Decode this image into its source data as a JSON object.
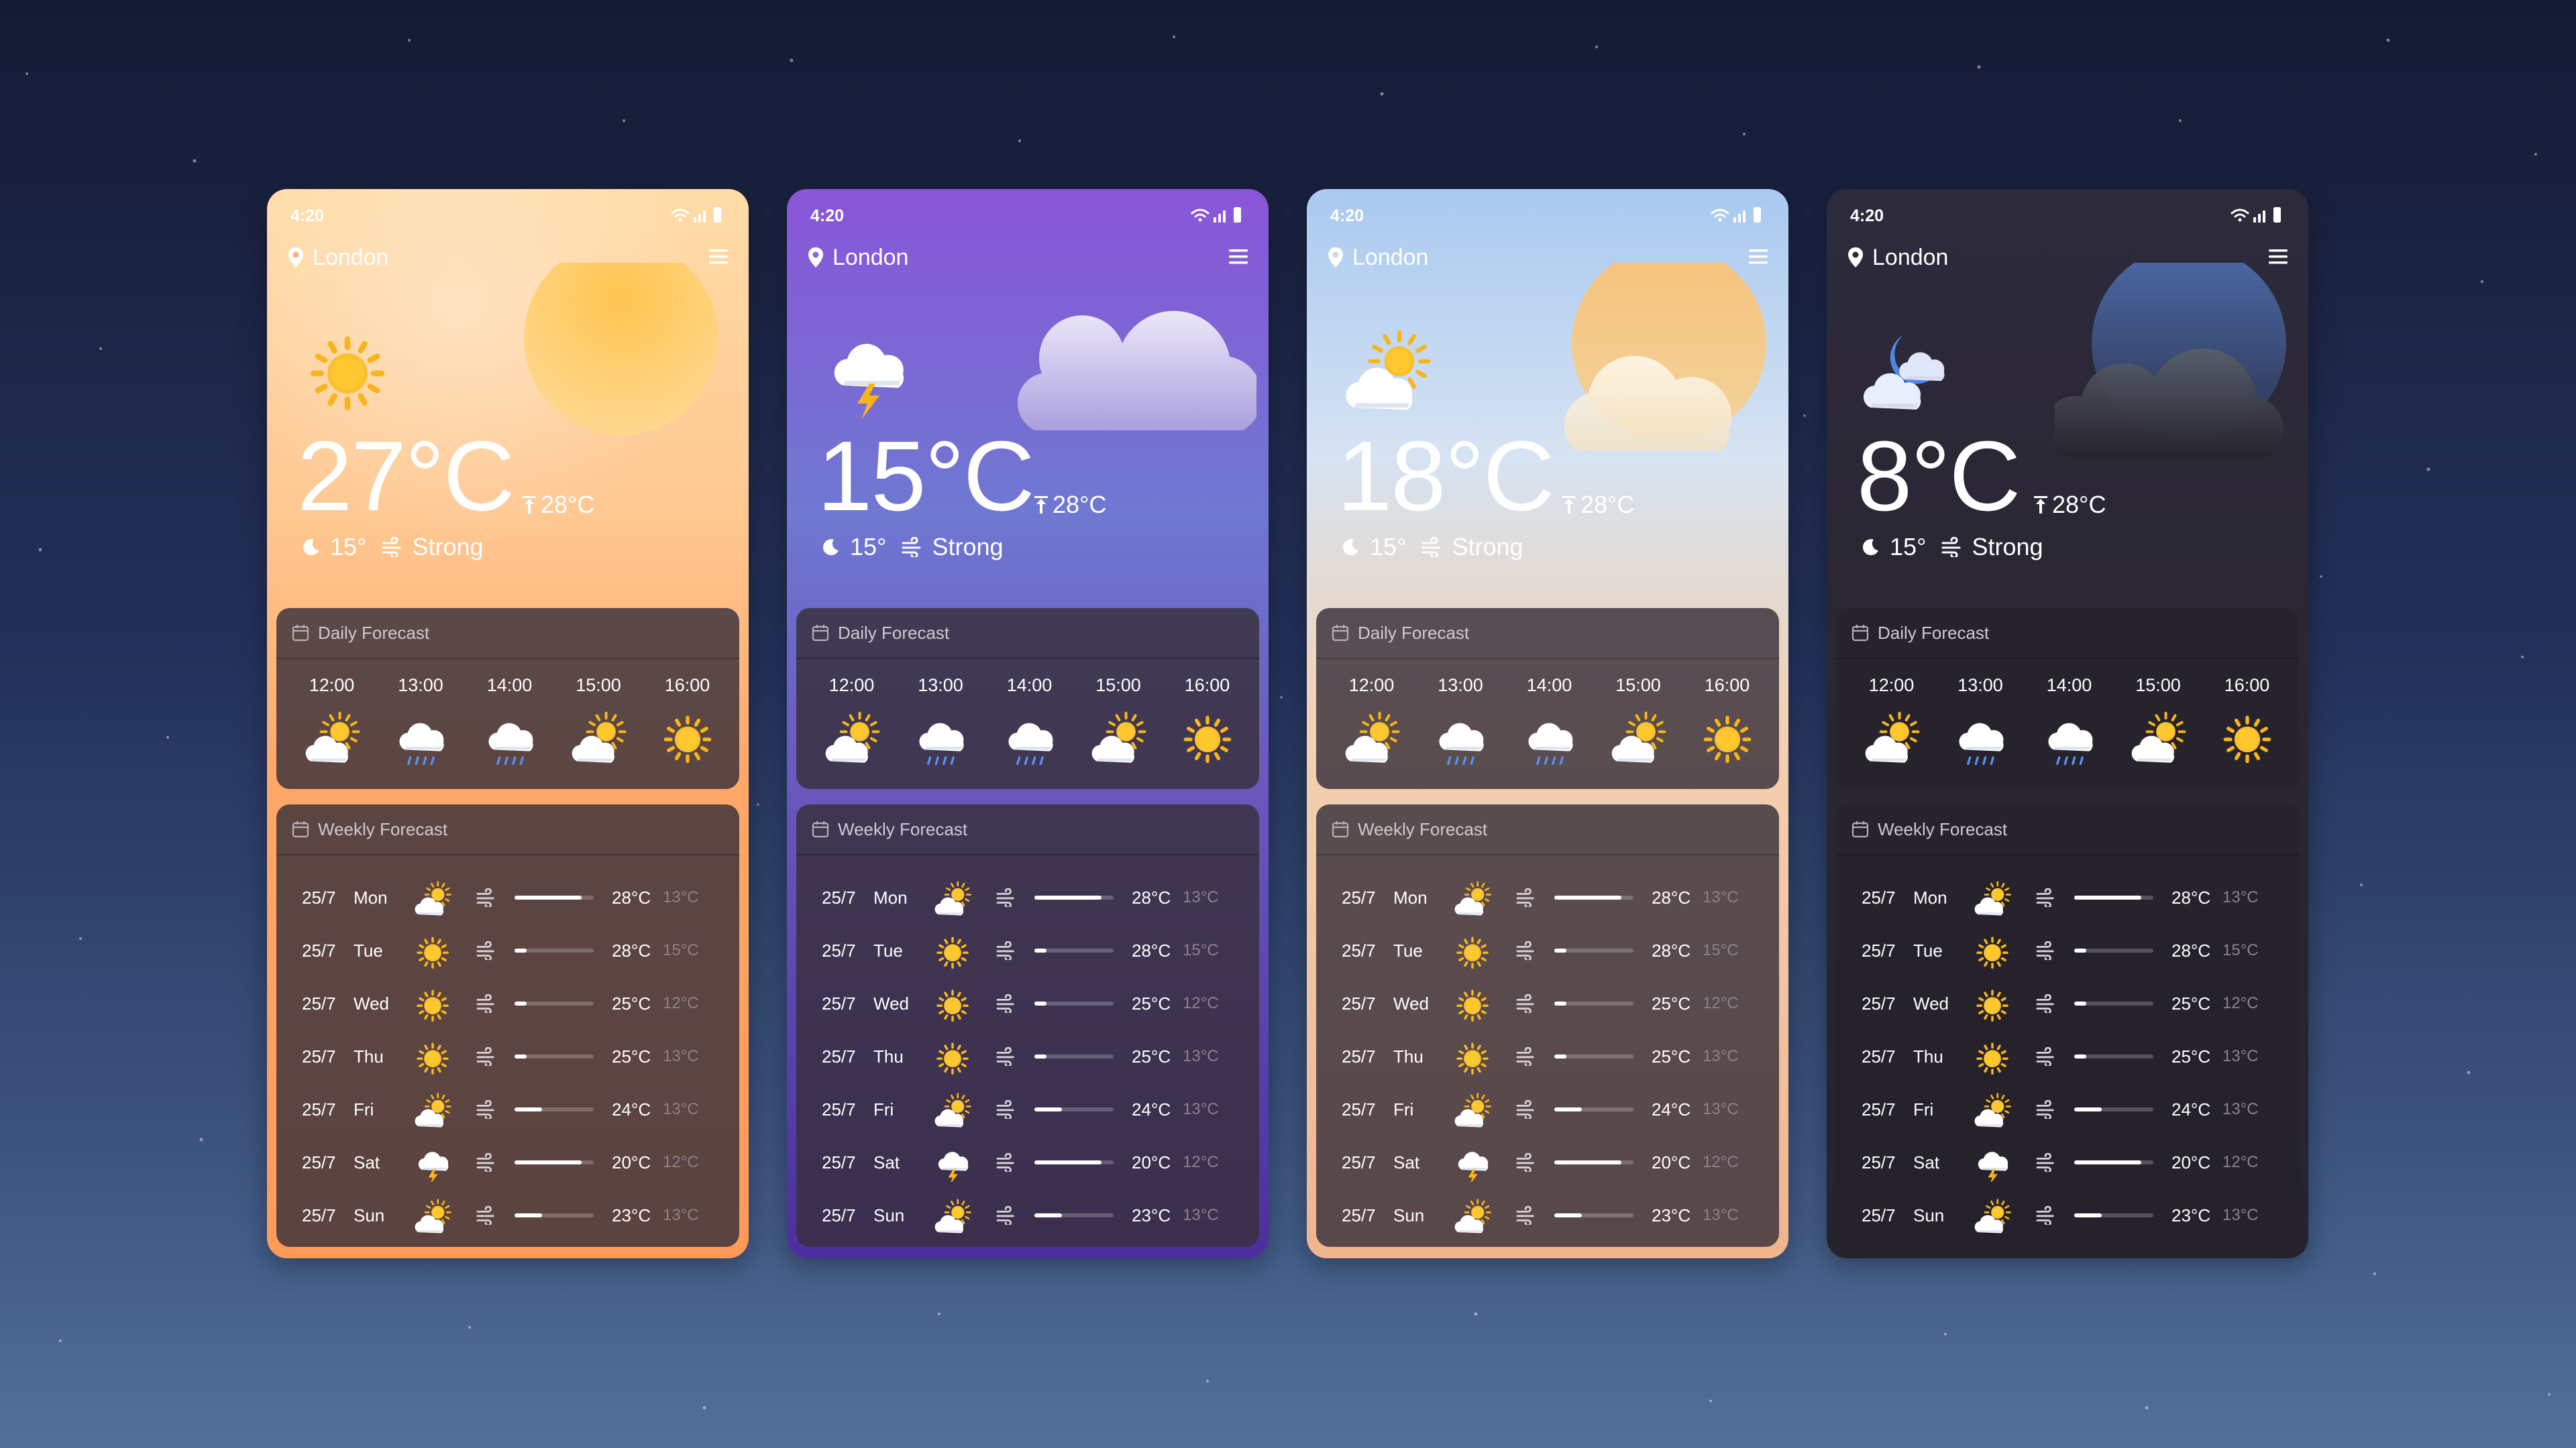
{
  "cards": [
    {
      "theme": "sunny",
      "status_time": "4:20",
      "location": "London",
      "temperature": "27°C",
      "high": "28°C",
      "low": "15°",
      "wind": "Strong",
      "condition_icon": "sun-icon",
      "daily_title": "Daily Forecast",
      "weekly_title": "Weekly Forecast",
      "hours": [
        {
          "time": "12:00",
          "icon": "partly-cloudy-icon"
        },
        {
          "time": "13:00",
          "icon": "rain-cloud-icon"
        },
        {
          "time": "14:00",
          "icon": "rain-cloud-icon"
        },
        {
          "time": "15:00",
          "icon": "partly-cloudy-icon"
        },
        {
          "time": "16:00",
          "icon": "sun-icon"
        }
      ],
      "days": [
        {
          "date": "25/7",
          "day": "Mon",
          "icon": "partly-cloudy-icon",
          "wind_level": 0.85,
          "hi": "28°C",
          "lo": "13°C"
        },
        {
          "date": "25/7",
          "day": "Tue",
          "icon": "sun-icon",
          "wind_level": 0.15,
          "hi": "28°C",
          "lo": "15°C"
        },
        {
          "date": "25/7",
          "day": "Wed",
          "icon": "sun-icon",
          "wind_level": 0.15,
          "hi": "25°C",
          "lo": "12°C"
        },
        {
          "date": "25/7",
          "day": "Thu",
          "icon": "sun-icon",
          "wind_level": 0.15,
          "hi": "25°C",
          "lo": "13°C"
        },
        {
          "date": "25/7",
          "day": "Fri",
          "icon": "partly-cloudy-icon",
          "wind_level": 0.35,
          "hi": "24°C",
          "lo": "13°C"
        },
        {
          "date": "25/7",
          "day": "Sat",
          "icon": "storm-cloud-icon",
          "wind_level": 0.85,
          "hi": "20°C",
          "lo": "12°C"
        },
        {
          "date": "25/7",
          "day": "Sun",
          "icon": "partly-cloudy-icon",
          "wind_level": 0.35,
          "hi": "23°C",
          "lo": "13°C"
        }
      ]
    },
    {
      "theme": "storm",
      "status_time": "4:20",
      "location": "London",
      "temperature": "15°C",
      "high": "28°C",
      "low": "15°",
      "wind": "Strong",
      "condition_icon": "storm-cloud-icon",
      "daily_title": "Daily Forecast",
      "weekly_title": "Weekly Forecast",
      "hours": [
        {
          "time": "12:00",
          "icon": "partly-cloudy-icon"
        },
        {
          "time": "13:00",
          "icon": "rain-cloud-icon"
        },
        {
          "time": "14:00",
          "icon": "rain-cloud-icon"
        },
        {
          "time": "15:00",
          "icon": "partly-cloudy-icon"
        },
        {
          "time": "16:00",
          "icon": "sun-icon"
        }
      ],
      "days": [
        {
          "date": "25/7",
          "day": "Mon",
          "icon": "partly-cloudy-icon",
          "wind_level": 0.85,
          "hi": "28°C",
          "lo": "13°C"
        },
        {
          "date": "25/7",
          "day": "Tue",
          "icon": "sun-icon",
          "wind_level": 0.15,
          "hi": "28°C",
          "lo": "15°C"
        },
        {
          "date": "25/7",
          "day": "Wed",
          "icon": "sun-icon",
          "wind_level": 0.15,
          "hi": "25°C",
          "lo": "12°C"
        },
        {
          "date": "25/7",
          "day": "Thu",
          "icon": "sun-icon",
          "wind_level": 0.15,
          "hi": "25°C",
          "lo": "13°C"
        },
        {
          "date": "25/7",
          "day": "Fri",
          "icon": "partly-cloudy-icon",
          "wind_level": 0.35,
          "hi": "24°C",
          "lo": "13°C"
        },
        {
          "date": "25/7",
          "day": "Sat",
          "icon": "storm-cloud-icon",
          "wind_level": 0.85,
          "hi": "20°C",
          "lo": "12°C"
        },
        {
          "date": "25/7",
          "day": "Sun",
          "icon": "partly-cloudy-icon",
          "wind_level": 0.35,
          "hi": "23°C",
          "lo": "13°C"
        }
      ]
    },
    {
      "theme": "partly",
      "status_time": "4:20",
      "location": "London",
      "temperature": "18°C",
      "high": "28°C",
      "low": "15°",
      "wind": "Strong",
      "condition_icon": "partly-cloudy-icon",
      "daily_title": "Daily Forecast",
      "weekly_title": "Weekly Forecast",
      "hours": [
        {
          "time": "12:00",
          "icon": "partly-cloudy-icon"
        },
        {
          "time": "13:00",
          "icon": "rain-cloud-icon"
        },
        {
          "time": "14:00",
          "icon": "rain-cloud-icon"
        },
        {
          "time": "15:00",
          "icon": "partly-cloudy-icon"
        },
        {
          "time": "16:00",
          "icon": "sun-icon"
        }
      ],
      "days": [
        {
          "date": "25/7",
          "day": "Mon",
          "icon": "partly-cloudy-icon",
          "wind_level": 0.85,
          "hi": "28°C",
          "lo": "13°C"
        },
        {
          "date": "25/7",
          "day": "Tue",
          "icon": "sun-icon",
          "wind_level": 0.15,
          "hi": "28°C",
          "lo": "15°C"
        },
        {
          "date": "25/7",
          "day": "Wed",
          "icon": "sun-icon",
          "wind_level": 0.15,
          "hi": "25°C",
          "lo": "12°C"
        },
        {
          "date": "25/7",
          "day": "Thu",
          "icon": "sun-icon",
          "wind_level": 0.15,
          "hi": "25°C",
          "lo": "13°C"
        },
        {
          "date": "25/7",
          "day": "Fri",
          "icon": "partly-cloudy-icon",
          "wind_level": 0.35,
          "hi": "24°C",
          "lo": "13°C"
        },
        {
          "date": "25/7",
          "day": "Sat",
          "icon": "storm-cloud-icon",
          "wind_level": 0.85,
          "hi": "20°C",
          "lo": "12°C"
        },
        {
          "date": "25/7",
          "day": "Sun",
          "icon": "partly-cloudy-icon",
          "wind_level": 0.35,
          "hi": "23°C",
          "lo": "13°C"
        }
      ]
    },
    {
      "theme": "night",
      "status_time": "4:20",
      "location": "London",
      "temperature": "8°C",
      "high": "28°C",
      "low": "15°",
      "wind": "Strong",
      "condition_icon": "moon-cloud-icon",
      "daily_title": "Daily Forecast",
      "weekly_title": "Weekly Forecast",
      "hours": [
        {
          "time": "12:00",
          "icon": "partly-cloudy-icon"
        },
        {
          "time": "13:00",
          "icon": "rain-cloud-icon"
        },
        {
          "time": "14:00",
          "icon": "rain-cloud-icon"
        },
        {
          "time": "15:00",
          "icon": "partly-cloudy-icon"
        },
        {
          "time": "16:00",
          "icon": "sun-icon"
        }
      ],
      "days": [
        {
          "date": "25/7",
          "day": "Mon",
          "icon": "partly-cloudy-icon",
          "wind_level": 0.85,
          "hi": "28°C",
          "lo": "13°C"
        },
        {
          "date": "25/7",
          "day": "Tue",
          "icon": "sun-icon",
          "wind_level": 0.15,
          "hi": "28°C",
          "lo": "15°C"
        },
        {
          "date": "25/7",
          "day": "Wed",
          "icon": "sun-icon",
          "wind_level": 0.15,
          "hi": "25°C",
          "lo": "12°C"
        },
        {
          "date": "25/7",
          "day": "Thu",
          "icon": "sun-icon",
          "wind_level": 0.15,
          "hi": "25°C",
          "lo": "13°C"
        },
        {
          "date": "25/7",
          "day": "Fri",
          "icon": "partly-cloudy-icon",
          "wind_level": 0.35,
          "hi": "24°C",
          "lo": "13°C"
        },
        {
          "date": "25/7",
          "day": "Sat",
          "icon": "storm-cloud-icon",
          "wind_level": 0.85,
          "hi": "20°C",
          "lo": "12°C"
        },
        {
          "date": "25/7",
          "day": "Sun",
          "icon": "partly-cloudy-icon",
          "wind_level": 0.35,
          "hi": "23°C",
          "lo": "13°C"
        }
      ]
    }
  ]
}
